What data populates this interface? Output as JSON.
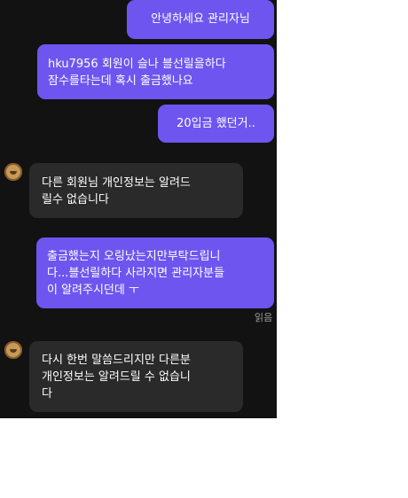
{
  "conversation": {
    "messages": [
      {
        "sender": "me",
        "text": "안녕하세요 관리자님"
      },
      {
        "sender": "me",
        "text": "hku7956 회원이 슬나 블선릴을하다\n잠수를타는데 혹시 출금했나요"
      },
      {
        "sender": "me",
        "text": "20입금 했던거.."
      },
      {
        "sender": "admin",
        "text": "다른 회원님 개인정보는 알려드\n릴수 없습니다"
      },
      {
        "sender": "me",
        "text": "출금했는지 오링났는지만부탁드립니\n다...블선릴하다 사라지면 관리자분들\n이 알려주시던데 ㅜ"
      },
      {
        "sender": "admin",
        "text": "다시 한번 말씀드리지만 다른분\n개인정보는 알려드릴 수 없습니\n다"
      }
    ],
    "read_receipt": "읽음"
  },
  "colors": {
    "background": "#121212",
    "sent_bubble": "#6f55f0",
    "received_bubble": "#2a2a2a",
    "text": "#ffffff",
    "read_receipt": "#9a9a9a"
  },
  "icons": {
    "admin_avatar": "avatar-icon"
  }
}
